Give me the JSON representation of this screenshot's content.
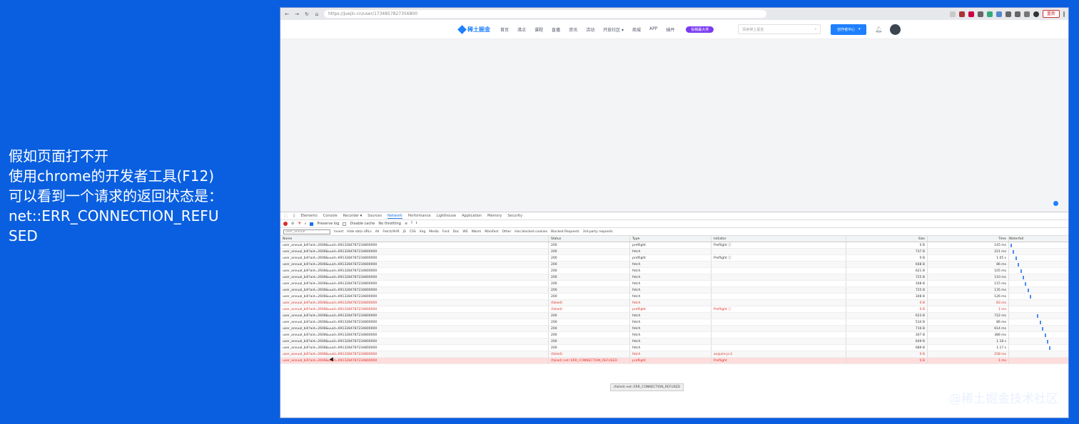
{
  "caption": {
    "line1": "假如页面打不开",
    "line2": "使用chrome的开发者工具(F12)",
    "line3": "可以看到一个请求的返回状态是：",
    "line4": "net::ERR_CONNECTION_REFU",
    "line5": "SED"
  },
  "browser": {
    "url": "https://juejin.cn/user/1734857827356800",
    "reset_label": "重新"
  },
  "site": {
    "logo": "稀土掘金",
    "menu": [
      "首页",
      "沸点",
      "课程",
      "直播",
      "资讯",
      "活动",
      "开放社区 ▾",
      "商城",
      "APP",
      "插件"
    ],
    "promo": "投稿赢大奖",
    "search_placeholder": "探索稀土掘金",
    "create_label": "创作者中心"
  },
  "devtools": {
    "tabs": [
      "Elements",
      "Console",
      "Recorder ⏺",
      "Sources",
      "Network",
      "Performance",
      "Lighthouse",
      "Application",
      "Memory",
      "Security"
    ],
    "active_tab": "Network",
    "preserve_log": "Preserve log",
    "disable_cache": "Disable cache",
    "throttle": "No throttling",
    "filter_placeholder": "user_annual",
    "filter_items": [
      "Invert",
      "Hide data URLs",
      "All",
      "Fetch/XHR",
      "JS",
      "CSS",
      "Img",
      "Media",
      "Font",
      "Doc",
      "WS",
      "Wasm",
      "Manifest",
      "Other",
      "Has blocked cookies",
      "Blocked Requests",
      "3rd-party requests"
    ],
    "columns": [
      "Name",
      "Status",
      "Type",
      "Initiator",
      "Size",
      "Time",
      "Waterfall"
    ],
    "rows": [
      {
        "name": "user_annual_bill?aid=2608&uuid=6913284787234800000",
        "status": "200",
        "type": "preflight",
        "initiator": "Preflight ⓘ",
        "size": "0 B",
        "time": "145 ms",
        "kind": "ok"
      },
      {
        "name": "user_annual_bill?aid=2608&uuid=6913284787234800000",
        "status": "200",
        "type": "fetch",
        "initiator": "",
        "size": "737 B",
        "time": "221 ms",
        "kind": "ok"
      },
      {
        "name": "user_annual_bill?aid=2608&uuid=6913284787234800000",
        "status": "200",
        "type": "preflight",
        "initiator": "Preflight ⓘ",
        "size": "0 B",
        "time": "1.05 s",
        "kind": "ok"
      },
      {
        "name": "user_annual_bill?aid=2608&uuid=6913284787234800000",
        "status": "200",
        "type": "fetch",
        "initiator": "",
        "size": "648 B",
        "time": "86 ms",
        "kind": "ok"
      },
      {
        "name": "user_annual_bill?aid=2608&uuid=6913284787234800000",
        "status": "200",
        "type": "fetch",
        "initiator": "",
        "size": "621 B",
        "time": "105 ms",
        "kind": "ok"
      },
      {
        "name": "user_annual_bill?aid=2608&uuid=6913284787234800000",
        "status": "200",
        "type": "fetch",
        "initiator": "",
        "size": "725 B",
        "time": "110 ms",
        "kind": "ok"
      },
      {
        "name": "user_annual_bill?aid=2608&uuid=6913284787234800000",
        "status": "200",
        "type": "fetch",
        "initiator": "",
        "size": "348 B",
        "time": "115 ms",
        "kind": "ok"
      },
      {
        "name": "user_annual_bill?aid=2608&uuid=6913284787234800000",
        "status": "200",
        "type": "fetch",
        "initiator": "",
        "size": "725 B",
        "time": "135 ms",
        "kind": "ok"
      },
      {
        "name": "user_annual_bill?aid=2608&uuid=6913284787234800000",
        "status": "200",
        "type": "fetch",
        "initiator": "",
        "size": "348 B",
        "time": "126 ms",
        "kind": "ok"
      },
      {
        "name": "user_annual_bill?aid=2608&uuid=6913284787234800000",
        "status": "(failed)",
        "type": "fetch",
        "initiator": "",
        "size": "0 B",
        "time": "83 ms",
        "kind": "err"
      },
      {
        "name": "user_annual_bill?aid=2608&uuid=6913284787234800000",
        "status": "(failed)",
        "type": "preflight",
        "initiator": "Preflight ⓘ",
        "size": "0 B",
        "time": "1 ms",
        "kind": "err"
      },
      {
        "name": "user_annual_bill?aid=2608&uuid=6913284787234800000",
        "status": "200",
        "type": "fetch",
        "initiator": "",
        "size": "623 B",
        "time": "722 ms",
        "kind": "ok"
      },
      {
        "name": "user_annual_bill?aid=2608&uuid=6913284787234800000",
        "status": "200",
        "type": "fetch",
        "initiator": "",
        "size": "534 B",
        "time": "86 ms",
        "kind": "ok"
      },
      {
        "name": "user_annual_bill?aid=2608&uuid=6913284787234800000",
        "status": "200",
        "type": "fetch",
        "initiator": "",
        "size": "716 B",
        "time": "614 ms",
        "kind": "ok"
      },
      {
        "name": "user_annual_bill?aid=2608&uuid=6913284787234800000",
        "status": "200",
        "type": "fetch",
        "initiator": "",
        "size": "307 B",
        "time": "386 ms",
        "kind": "ok"
      },
      {
        "name": "user_annual_bill?aid=2608&uuid=6913284787234800000",
        "status": "200",
        "type": "fetch",
        "initiator": "",
        "size": "649 B",
        "time": "1.18 s",
        "kind": "ok"
      },
      {
        "name": "user_annual_bill?aid=2608&uuid=6913284787234800000",
        "status": "200",
        "type": "fetch",
        "initiator": "",
        "size": "689 B",
        "time": "1.17 s",
        "kind": "ok"
      },
      {
        "name": "user_annual_bill?aid=2608&uuid=6913284787234800000",
        "status": "(failed)",
        "type": "fetch",
        "initiator": "acquire.js:2",
        "size": "0 B",
        "time": "258 ms",
        "kind": "err"
      },
      {
        "name": "user_annual_bill?aid=2608&uuid=6913284787234800000",
        "status": "(failed) net::ERR_CONNECTION_REFUSED",
        "type": "preflight",
        "initiator": "Preflight",
        "size": "0 B",
        "time": "1 ms",
        "kind": "err-sel"
      }
    ],
    "tooltip": "(failed) net::ERR_CONNECTION_REFUSED"
  },
  "watermark": "@稀土掘金技术社区",
  "colors": {
    "background": "#0a5fe0",
    "accent": "#1e80ff",
    "error": "#d93025"
  }
}
